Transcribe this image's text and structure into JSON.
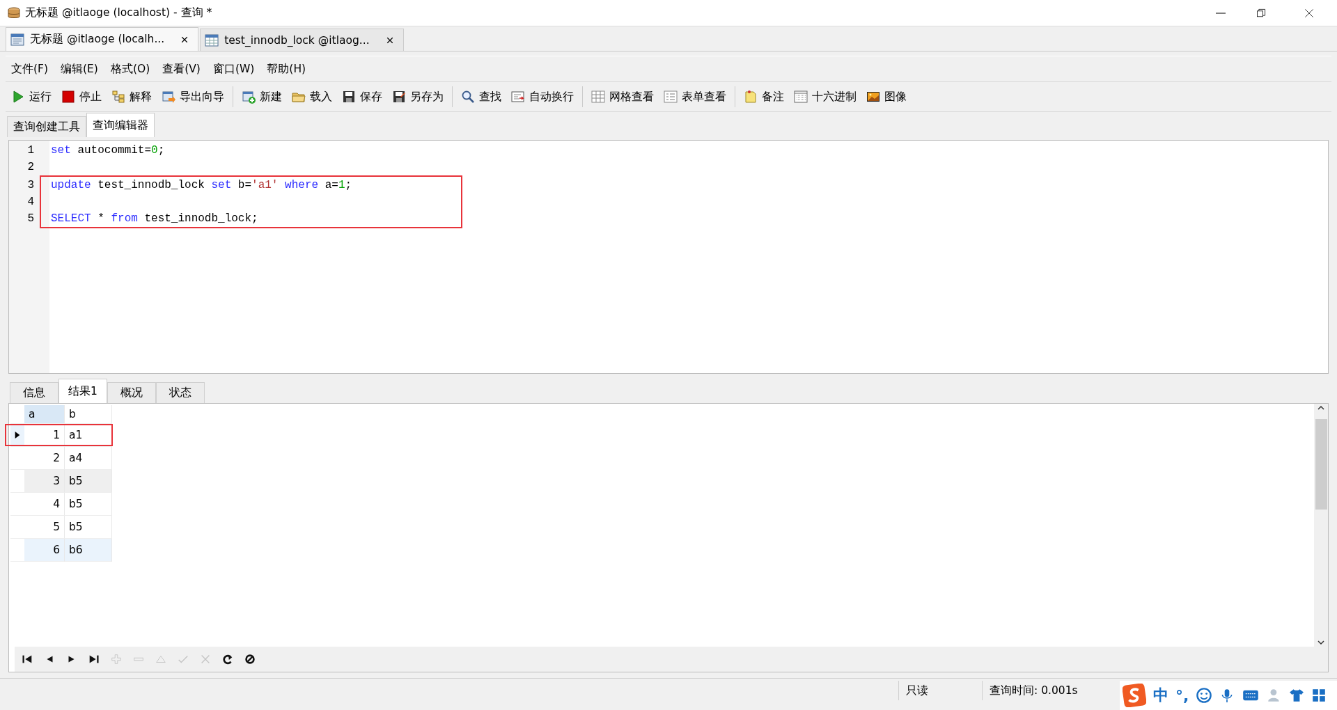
{
  "window": {
    "title": "无标题 @itlaoge (localhost) - 查询 *"
  },
  "doc_tabs": [
    {
      "label": "无标题 @itlaoge (localh...",
      "selected": true,
      "kind": "query"
    },
    {
      "label": "test_innodb_lock @itlaog...",
      "selected": false,
      "kind": "table"
    }
  ],
  "menu": [
    "文件(F)",
    "编辑(E)",
    "格式(O)",
    "查看(V)",
    "窗口(W)",
    "帮助(H)"
  ],
  "toolbar": [
    [
      {
        "kind": "run",
        "label": "运行"
      },
      {
        "kind": "stop",
        "label": "停止"
      },
      {
        "kind": "explain",
        "label": "解释"
      },
      {
        "kind": "export",
        "label": "导出向导"
      }
    ],
    [
      {
        "kind": "new",
        "label": "新建"
      },
      {
        "kind": "load",
        "label": "载入"
      },
      {
        "kind": "save",
        "label": "保存"
      },
      {
        "kind": "saveas",
        "label": "另存为"
      }
    ],
    [
      {
        "kind": "find",
        "label": "查找"
      },
      {
        "kind": "wrap",
        "label": "自动换行"
      }
    ],
    [
      {
        "kind": "grid",
        "label": "网格查看"
      },
      {
        "kind": "form",
        "label": "表单查看"
      }
    ],
    [
      {
        "kind": "note",
        "label": "备注"
      },
      {
        "kind": "hex",
        "label": "十六进制"
      },
      {
        "kind": "image",
        "label": "图像"
      }
    ]
  ],
  "editor_tabs": [
    {
      "label": "查询创建工具",
      "selected": false
    },
    {
      "label": "查询编辑器",
      "selected": true
    }
  ],
  "editor": {
    "lines": [
      {
        "number": "1",
        "boxed": false,
        "tokens": [
          {
            "kind": "keyword",
            "text": "set"
          },
          {
            "kind": "plain",
            "text": " autocommit="
          },
          {
            "kind": "number",
            "text": "0"
          },
          {
            "kind": "plain",
            "text": ";"
          }
        ]
      },
      {
        "number": "2",
        "boxed": false
      },
      {
        "number": "3",
        "boxed": true,
        "tokens": [
          {
            "kind": "keyword",
            "text": "update"
          },
          {
            "kind": "plain",
            "text": " test_innodb_lock "
          },
          {
            "kind": "keyword",
            "text": "set"
          },
          {
            "kind": "plain",
            "text": " b="
          },
          {
            "kind": "string",
            "text": "'a1'"
          },
          {
            "kind": "keyword",
            "text": " where"
          },
          {
            "kind": "plain",
            "text": " a="
          },
          {
            "kind": "number",
            "text": "1"
          },
          {
            "kind": "plain",
            "text": ";"
          }
        ]
      },
      {
        "number": "4",
        "boxed": true
      },
      {
        "number": "5",
        "boxed": true,
        "tokens": [
          {
            "kind": "keyword",
            "text": "SELECT"
          },
          {
            "kind": "plain",
            "text": " * "
          },
          {
            "kind": "keyword",
            "text": "from"
          },
          {
            "kind": "plain",
            "text": " test_innodb_lock;"
          }
        ]
      }
    ]
  },
  "result_tabs": [
    {
      "label": "信息",
      "selected": false
    },
    {
      "label": "结果1",
      "selected": true
    },
    {
      "label": "概况",
      "selected": false
    },
    {
      "label": "状态",
      "selected": false
    }
  ],
  "grid": {
    "columns": [
      {
        "name": "a",
        "focused": true
      },
      {
        "name": "b",
        "focused": false
      }
    ],
    "rows": [
      {
        "cells": [
          "1",
          "a1"
        ],
        "current": true,
        "hovered": false,
        "selected": false,
        "boxed": true
      },
      {
        "cells": [
          "2",
          "a4"
        ],
        "current": false,
        "hovered": false,
        "selected": false,
        "boxed": false
      },
      {
        "cells": [
          "3",
          "b5"
        ],
        "current": false,
        "hovered": true,
        "selected": false,
        "boxed": false
      },
      {
        "cells": [
          "4",
          "b5"
        ],
        "current": false,
        "hovered": false,
        "selected": false,
        "boxed": false
      },
      {
        "cells": [
          "5",
          "b5"
        ],
        "current": false,
        "hovered": false,
        "selected": false,
        "boxed": false
      },
      {
        "cells": [
          "6",
          "b6"
        ],
        "current": false,
        "hovered": false,
        "selected": true,
        "boxed": false
      }
    ]
  },
  "nav_bar": [
    {
      "kind": "first",
      "disabled": false
    },
    {
      "kind": "prev",
      "disabled": false
    },
    {
      "kind": "next",
      "disabled": false
    },
    {
      "kind": "last",
      "disabled": false
    },
    {
      "kind": "add",
      "disabled": true
    },
    {
      "kind": "delete",
      "disabled": true
    },
    {
      "kind": "up",
      "disabled": true
    },
    {
      "kind": "apply",
      "disabled": true
    },
    {
      "kind": "cancel",
      "disabled": true
    },
    {
      "kind": "refresh",
      "disabled": false
    },
    {
      "kind": "stop",
      "disabled": false
    }
  ],
  "status_bar": {
    "mode": "只读",
    "query_time": "查询时间: 0.001s"
  },
  "ime_bar": {
    "language": "中",
    "punctuation": "°,"
  }
}
